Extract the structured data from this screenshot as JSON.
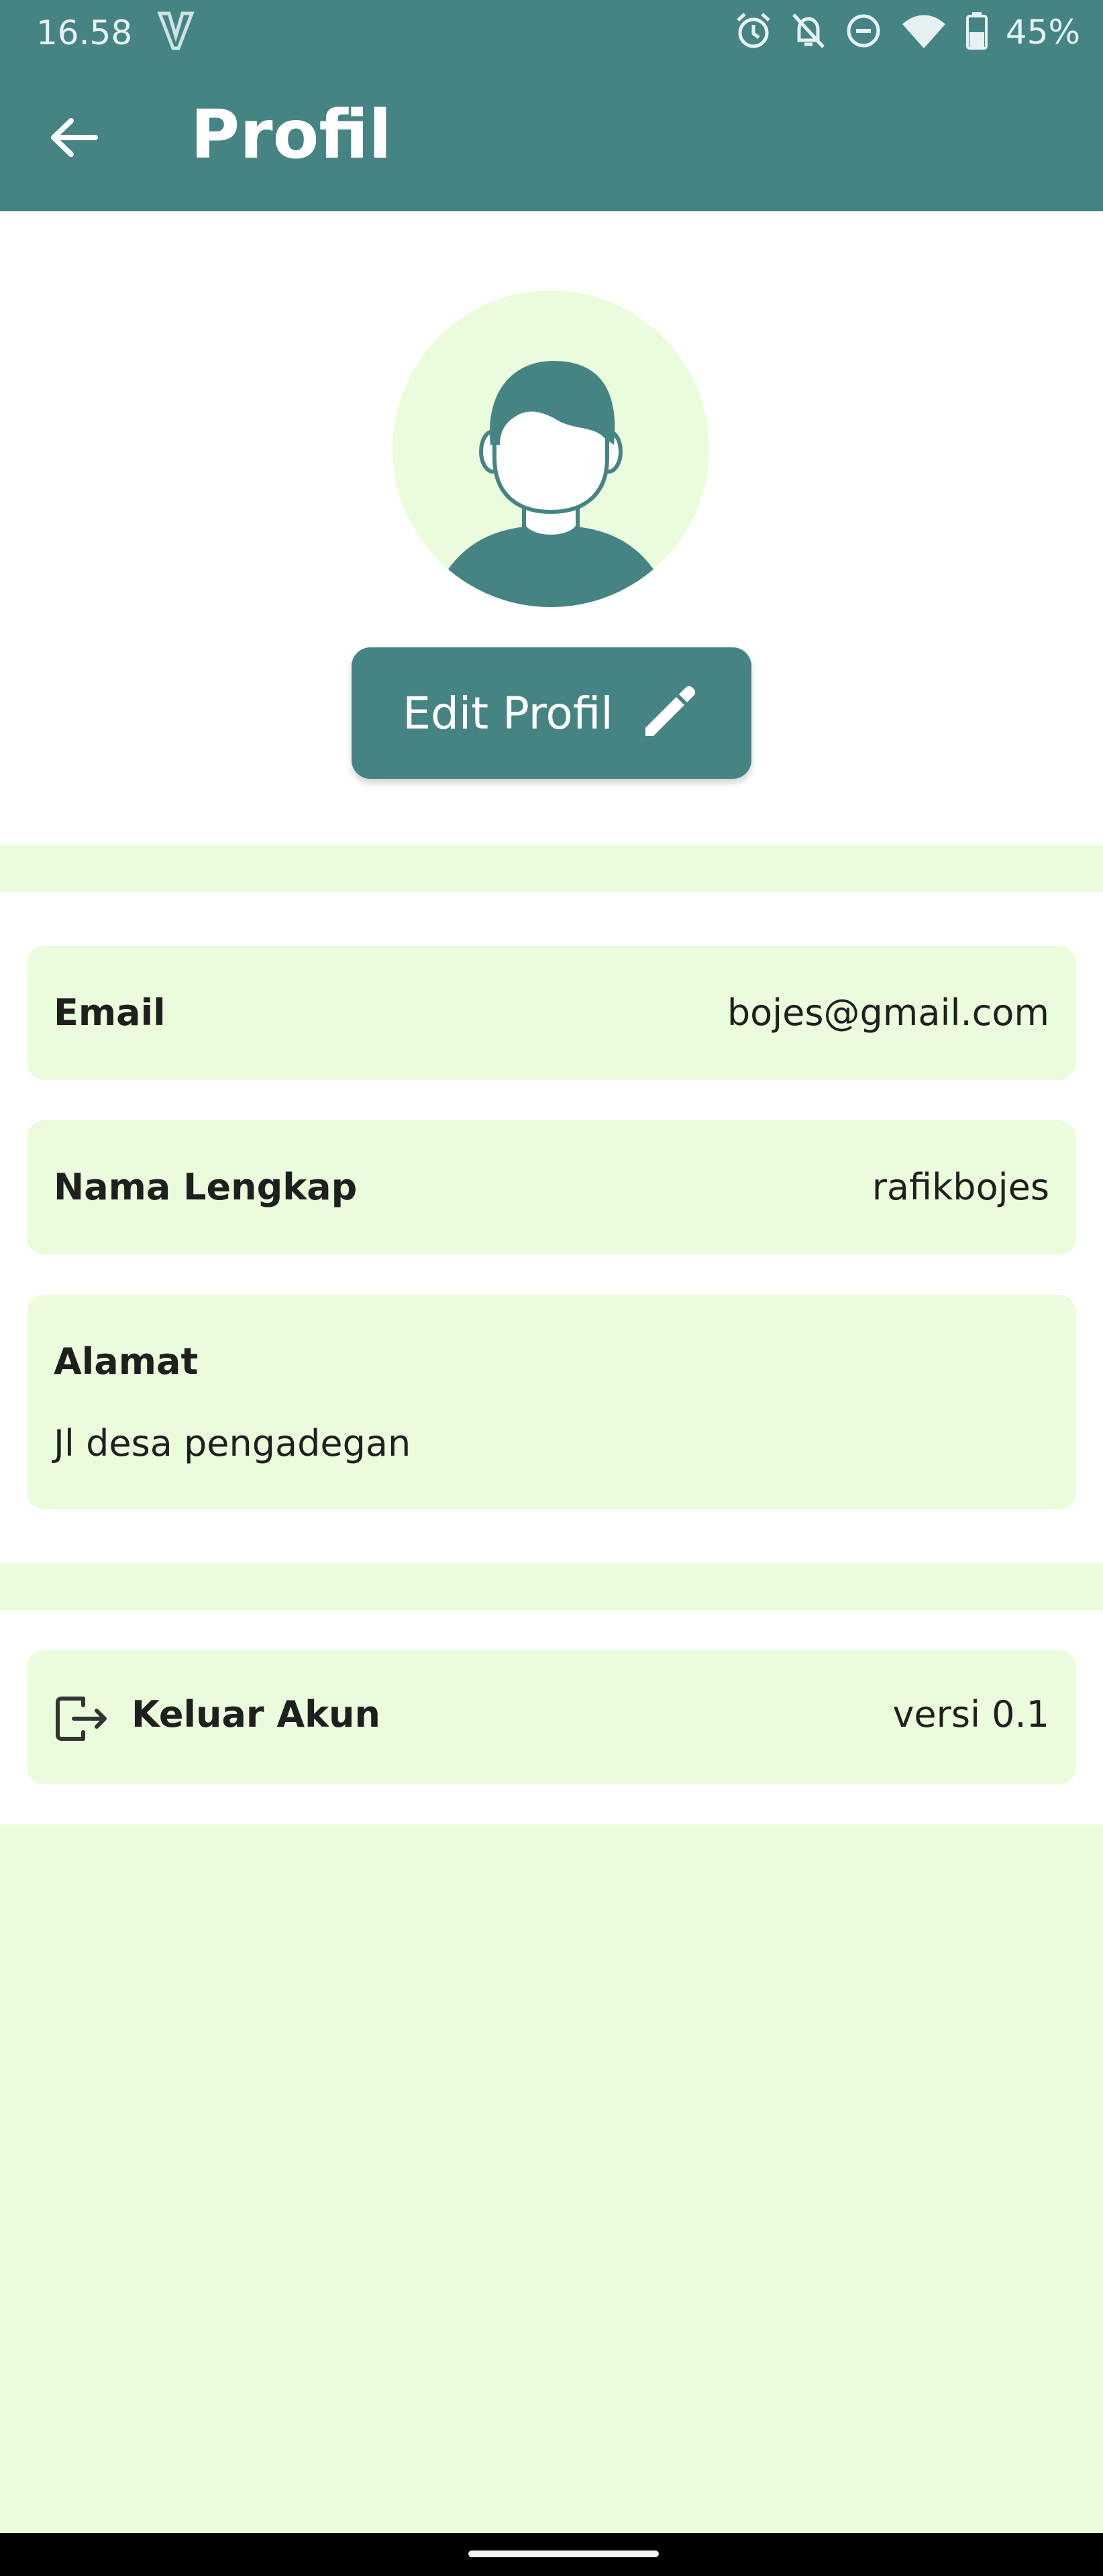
{
  "status_bar": {
    "time": "16.58",
    "battery": "45%",
    "icons": [
      "v-carrier-icon",
      "alarm-icon",
      "notifications-off-icon",
      "do-not-disturb-icon",
      "wifi-icon",
      "battery-icon"
    ]
  },
  "app_bar": {
    "title": "Profil",
    "back_icon": "arrow-back-icon"
  },
  "profile": {
    "avatar_icon": "person-avatar-icon",
    "edit_button_label": "Edit Profil",
    "edit_icon": "pencil-icon"
  },
  "details": {
    "email_label": "Email",
    "email_value": "bojes@gmail.com",
    "fullname_label": "Nama Lengkap",
    "fullname_value": "rafikbojes",
    "address_label": "Alamat",
    "address_value": "Jl desa pengadegan"
  },
  "logout": {
    "label": "Keluar Akun",
    "version": "versi 0.1",
    "icon": "logout-icon"
  },
  "colors": {
    "primary": "#468484",
    "card_bg": "#eafcdc",
    "surface": "#ffffff"
  }
}
